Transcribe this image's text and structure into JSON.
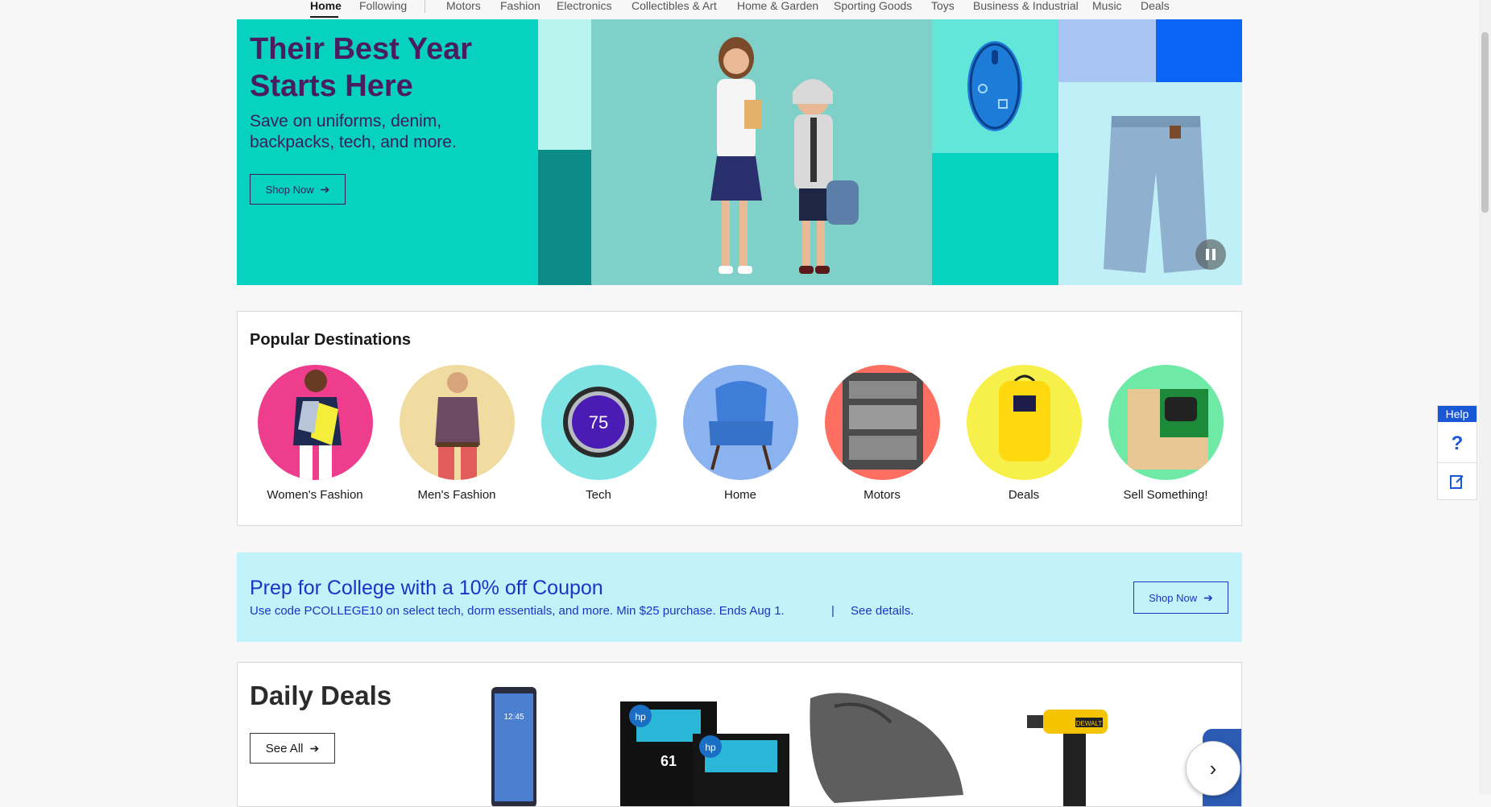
{
  "nav": {
    "items": [
      {
        "label": "Home",
        "active": true
      },
      {
        "label": "Following"
      },
      {
        "label": "Motors"
      },
      {
        "label": "Fashion"
      },
      {
        "label": "Electronics"
      },
      {
        "label": "Collectibles & Art"
      },
      {
        "label": "Home & Garden"
      },
      {
        "label": "Sporting Goods"
      },
      {
        "label": "Toys"
      },
      {
        "label": "Business & Industrial"
      },
      {
        "label": "Music"
      },
      {
        "label": "Deals"
      }
    ]
  },
  "hero": {
    "title": "Their Best Year Starts Here",
    "subtitle": "Save on uniforms, denim, backpacks, tech, and more.",
    "button": "Shop Now",
    "colors": {
      "bg": "#07d1bf",
      "title": "#4a1d63"
    }
  },
  "popular": {
    "title": "Popular Destinations",
    "items": [
      {
        "label": "Women's Fashion",
        "icon": "womens-fashion-image",
        "color": "#ee3d8d"
      },
      {
        "label": "Men's Fashion",
        "icon": "mens-fashion-image",
        "color": "#f0dca0"
      },
      {
        "label": "Tech",
        "icon": "thermostat-image",
        "color": "#7fe3e3"
      },
      {
        "label": "Home",
        "icon": "armchair-image",
        "color": "#8ab3f0"
      },
      {
        "label": "Motors",
        "icon": "toolkit-image",
        "color": "#ff6f61"
      },
      {
        "label": "Deals",
        "icon": "backpack-image",
        "color": "#f7f04a"
      },
      {
        "label": "Sell Something!",
        "icon": "box-image",
        "color": "#6ee9a6"
      }
    ]
  },
  "coupon": {
    "title": "Prep for College with a 10% off Coupon",
    "subtitle": "Use code PCOLLEGE10 on select tech, dorm essentials, and more. Min $25 purchase. Ends Aug 1.",
    "separator": "|",
    "link": "See details.",
    "button": "Shop Now"
  },
  "deals": {
    "title": "Daily Deals",
    "see_all": "See All",
    "product_labels": [
      "12:45",
      "hp",
      "61",
      "hp",
      "DEWALT"
    ]
  },
  "help": {
    "tab": "Help",
    "question": "?"
  },
  "colors": {
    "accent_blue": "#1a35c6",
    "help_blue": "#1a57d6"
  }
}
